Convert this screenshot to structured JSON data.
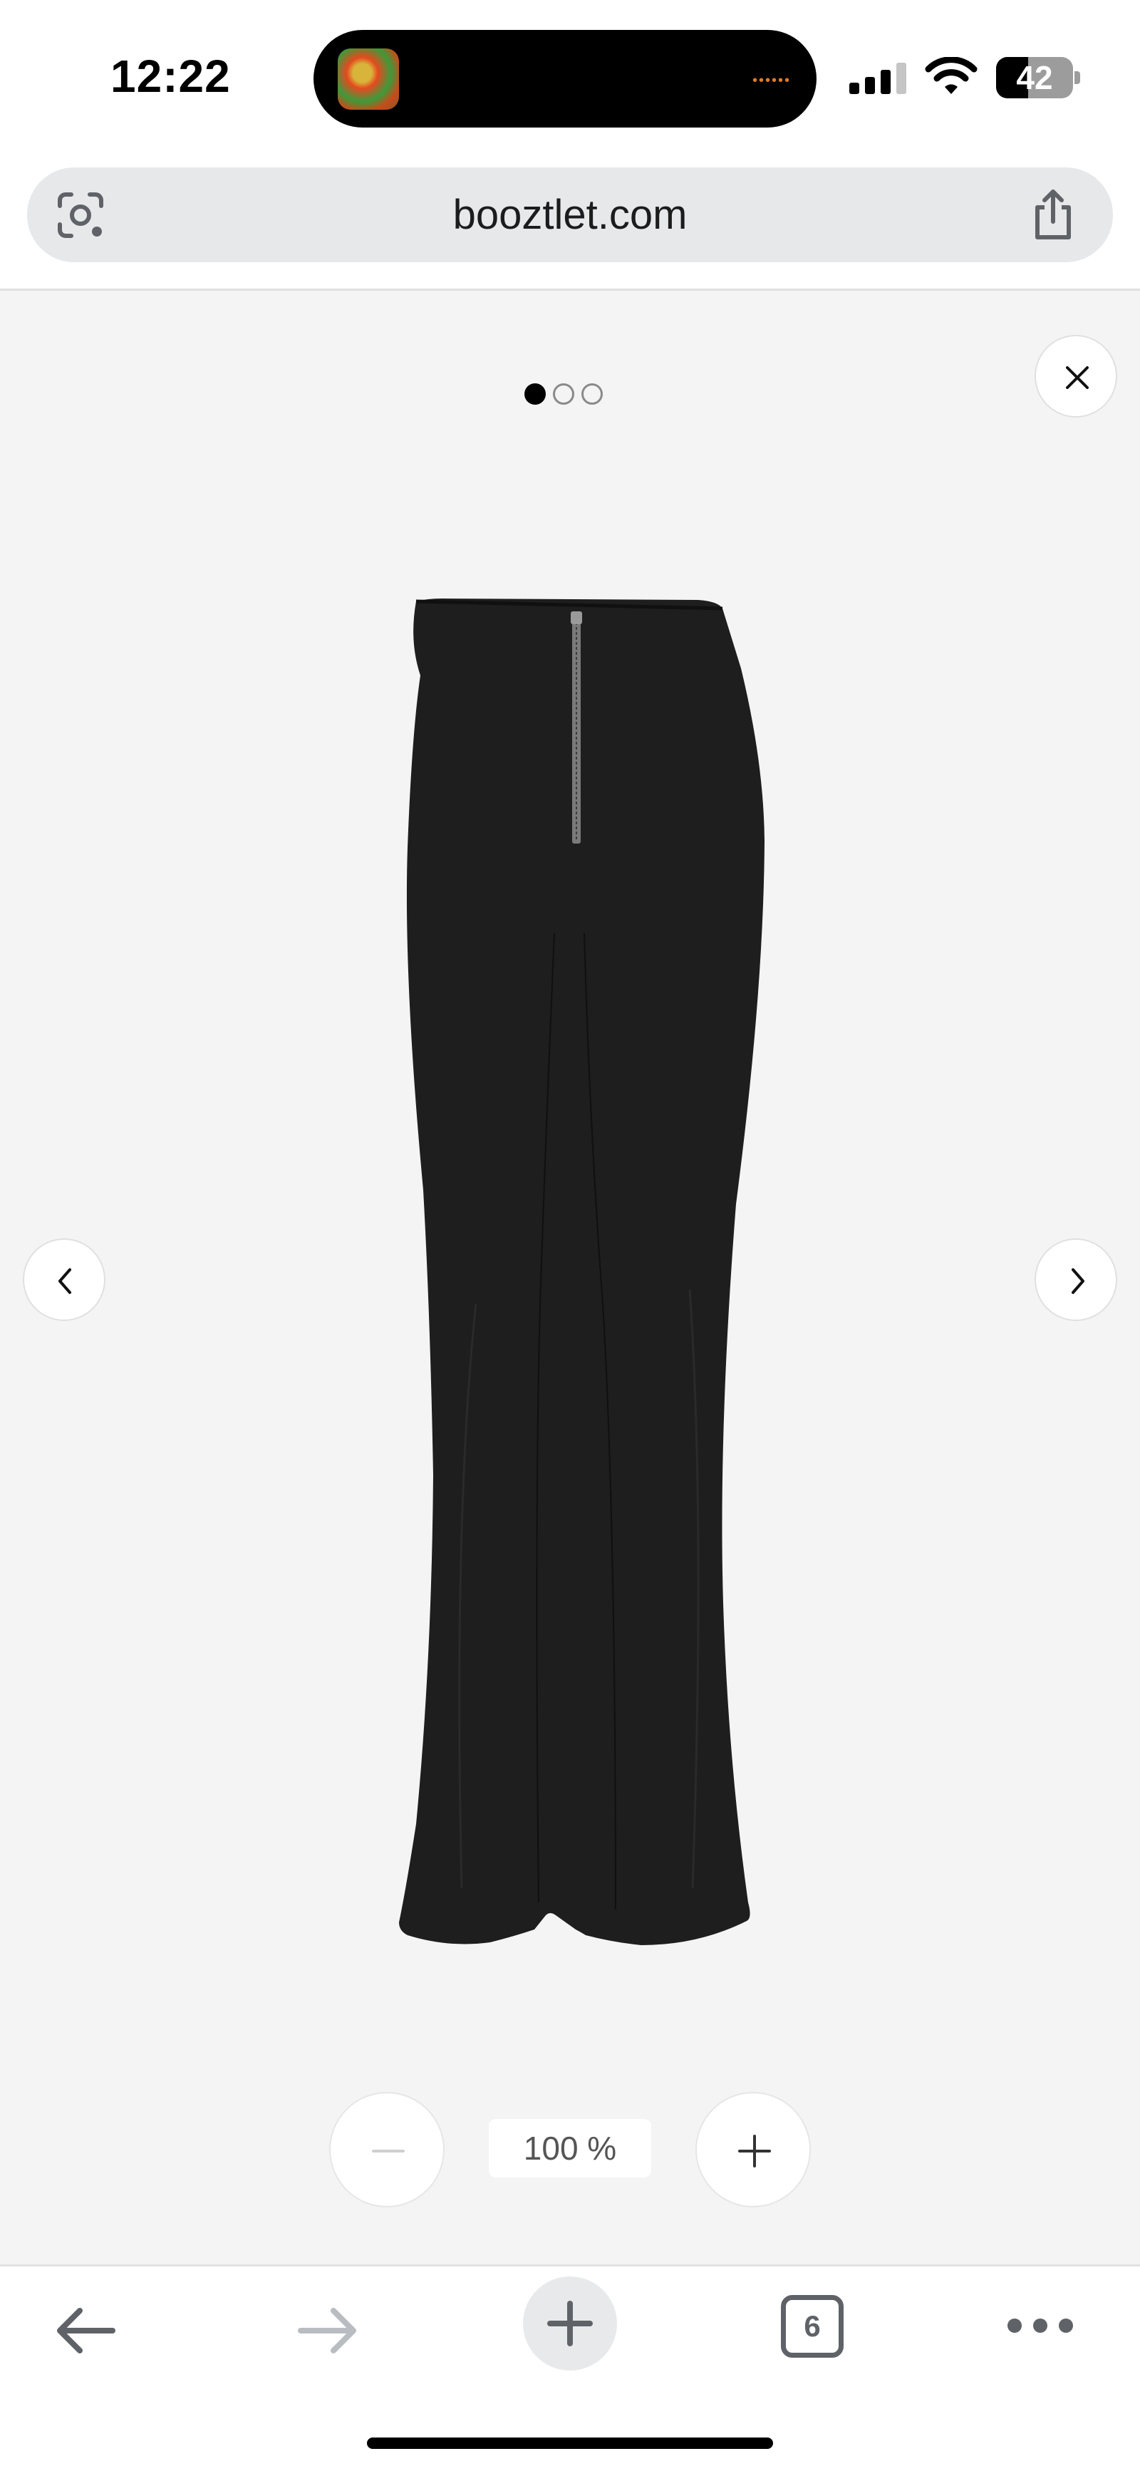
{
  "status_bar": {
    "time": "12:22",
    "battery_percent": "42",
    "battery_level": 0.42,
    "icons": [
      "app-activity-icon",
      "cellular-signal-icon",
      "wifi-icon",
      "battery-icon"
    ]
  },
  "address_bar": {
    "url": "booztlet.com",
    "left_icon": "lens-icon",
    "right_icon": "share-icon"
  },
  "viewer": {
    "image_count": 3,
    "current_image": 1,
    "image_subject": "black flared zip-front trousers",
    "zoom_level": "100 %",
    "controls": [
      "close-icon",
      "chevron-left-icon",
      "chevron-right-icon",
      "minus-icon",
      "plus-icon"
    ]
  },
  "toolbar": {
    "tab_count": "6",
    "icons": [
      "back-arrow-icon",
      "forward-arrow-icon",
      "new-tab-plus-icon",
      "tab-switcher-icon",
      "more-dots-icon"
    ]
  },
  "colors": {
    "viewer_background": "#f4f4f4",
    "address_bar_background": "#e7e8ea",
    "toolbar_icon": "#5f6368",
    "disabled_icon": "#b9bdc1",
    "product": "#1e1e1e"
  }
}
